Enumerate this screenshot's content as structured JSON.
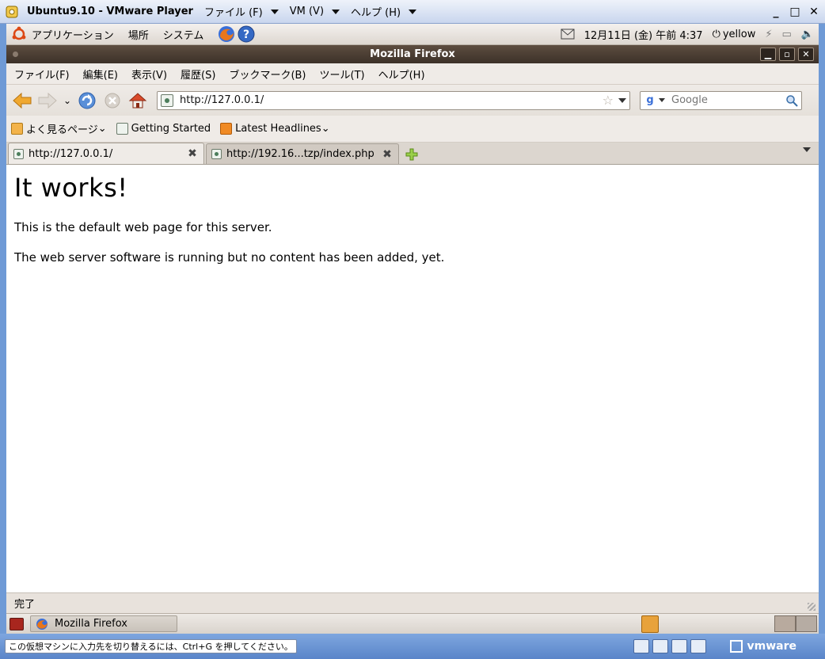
{
  "vm_window": {
    "title": "Ubuntu9.10 - VMware Player",
    "menus": [
      "ファイル (F)",
      "VM (V)",
      "ヘルプ (H)"
    ],
    "controls": [
      "_",
      "□",
      "✕"
    ]
  },
  "gnome_top": {
    "menus": [
      "アプリケーション",
      "場所",
      "システム"
    ],
    "datetime": "12月11日 (金) 午前 4:37",
    "user": "yellow"
  },
  "firefox": {
    "window_title": "Mozilla Firefox",
    "menus": [
      "ファイル(F)",
      "編集(E)",
      "表示(V)",
      "履歴(S)",
      "ブックマーク(B)",
      "ツール(T)",
      "ヘルプ(H)"
    ],
    "url": "http://127.0.0.1/",
    "search_placeholder": "Google",
    "bookmarks": [
      "よく見るページ",
      "Getting Started",
      "Latest Headlines"
    ],
    "tabs": [
      {
        "label": "http://127.0.0.1/",
        "active": true
      },
      {
        "label": "http://192.16...tzp/index.php",
        "active": false
      }
    ],
    "status": "完了"
  },
  "page": {
    "heading": "It works!",
    "paragraphs": [
      "This is the default web page for this server.",
      "The web server software is running but no content has been added, yet."
    ]
  },
  "taskbar": {
    "task": "Mozilla Firefox"
  },
  "vm_status": {
    "hint": "この仮想マシンに入力先を切り替えるには、Ctrl+G を押してください。",
    "brand": "vmware"
  },
  "colors": {
    "host_chrome": "#6f9ad6",
    "ff_titlebar": "#3c3129",
    "gnome_panel": "#efebe7"
  }
}
